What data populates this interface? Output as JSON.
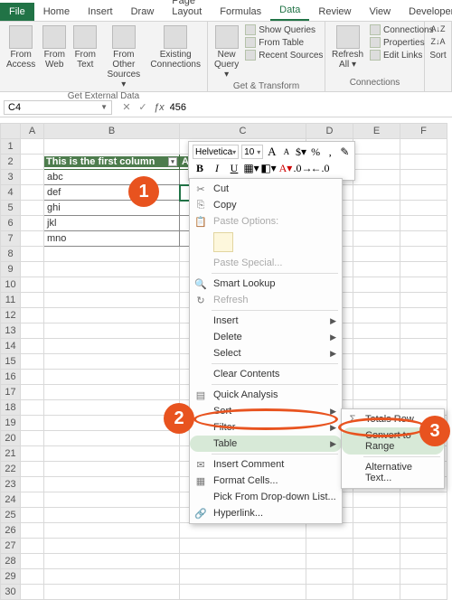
{
  "tabs": {
    "file": "File",
    "home": "Home",
    "insert": "Insert",
    "draw": "Draw",
    "page_layout": "Page Layout",
    "formulas": "Formulas",
    "data": "Data",
    "review": "Review",
    "view": "View",
    "developer": "Developer"
  },
  "ribbon": {
    "ext_data": {
      "from_access": "From\nAccess",
      "from_web": "From\nWeb",
      "from_text": "From\nText",
      "other": "From Other\nSources ▾",
      "existing": "Existing\nConnections",
      "label": "Get External Data"
    },
    "transform": {
      "new_query": "New\nQuery ▾",
      "show_queries": "Show Queries",
      "from_table": "From Table",
      "recent": "Recent Sources",
      "label": "Get & Transform"
    },
    "conn": {
      "refresh": "Refresh\nAll ▾",
      "connections": "Connections",
      "properties": "Properties",
      "edit_links": "Edit Links",
      "label": "Connections"
    },
    "sort": {
      "az": "A↓Z",
      "za": "Z↓A",
      "sort": "Sort"
    }
  },
  "name_box": "C4",
  "formula_value": "456",
  "columns": [
    "A",
    "B",
    "C",
    "D",
    "E",
    "F"
  ],
  "row_count": 30,
  "table_header": {
    "col_b": "This is the first column",
    "col_c": "An"
  },
  "table_rows": [
    "abc",
    "def",
    "ghi",
    "jkl",
    "mno"
  ],
  "c4_value": "456",
  "mini": {
    "font": "Helvetica",
    "size": "10",
    "aplus": "A",
    "aminus": "A",
    "percent": "%",
    "comma": ",",
    "b": "B",
    "i": "I",
    "u": "U"
  },
  "ctx": {
    "cut": "Cut",
    "copy": "Copy",
    "paste_options": "Paste Options:",
    "paste_special": "Paste Special...",
    "smart_lookup": "Smart Lookup",
    "refresh": "Refresh",
    "insert": "Insert",
    "delete": "Delete",
    "select": "Select",
    "clear": "Clear Contents",
    "quick": "Quick Analysis",
    "sort": "Sort",
    "filter": "Filter",
    "table": "Table",
    "insert_comment": "Insert Comment",
    "format_cells": "Format Cells...",
    "dropdown": "Pick From Drop-down List...",
    "hyperlink": "Hyperlink..."
  },
  "submenu": {
    "totals_row": "Totals Row",
    "convert": "Convert to Range",
    "alt_text": "Alternative Text..."
  },
  "callouts": {
    "one": "1",
    "two": "2",
    "three": "3"
  }
}
